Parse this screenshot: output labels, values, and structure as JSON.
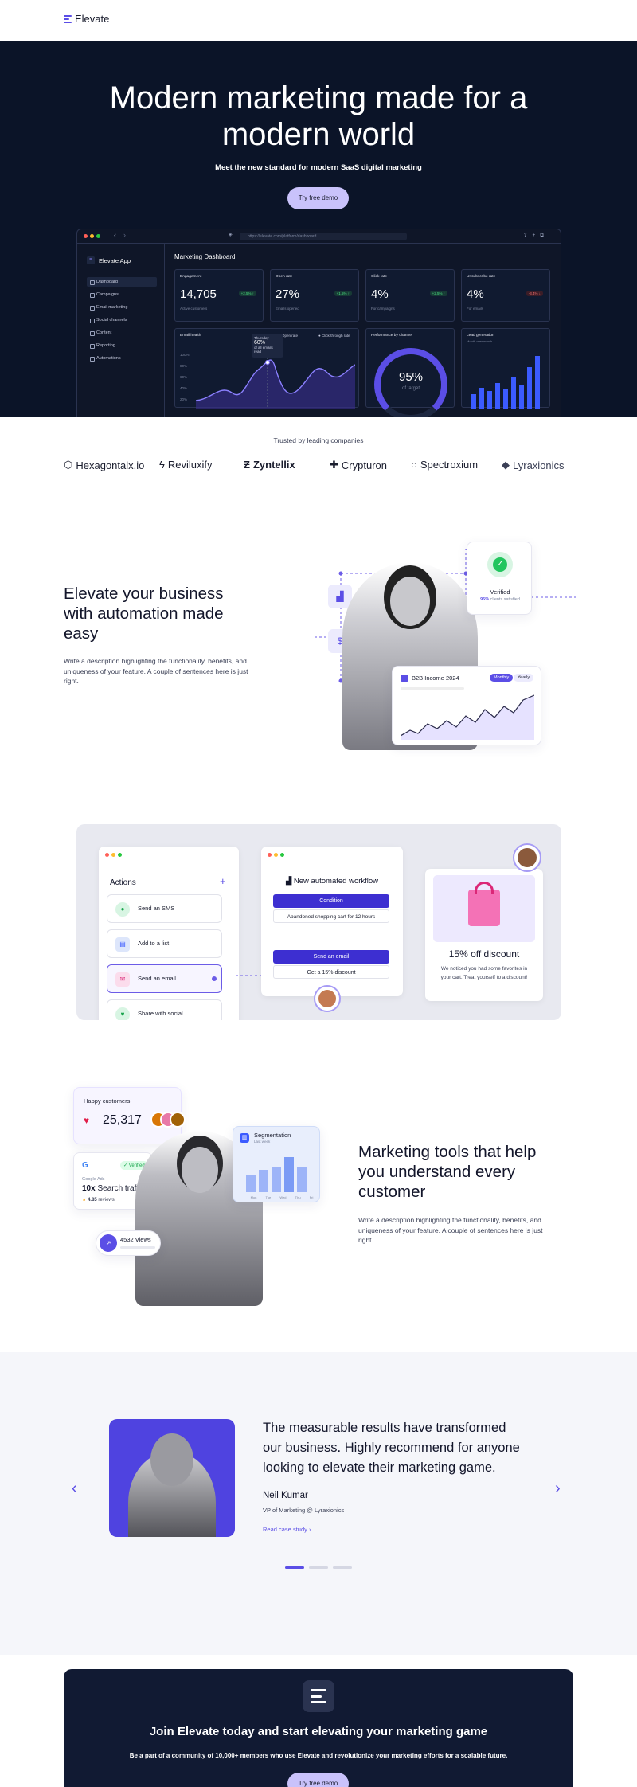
{
  "nav": {
    "brand": "Elevate"
  },
  "hero": {
    "title_line1": "Modern marketing made for a",
    "title_line2": "modern world",
    "subtitle": "Meet the new standard for modern SaaS digital marketing",
    "cta": "Try free demo"
  },
  "app": {
    "url": "https://elevate.com/platform/dashboard",
    "name": "Elevate App",
    "nav": [
      "Dashboard",
      "Campaigns",
      "Email marketing",
      "Social channels",
      "Content",
      "Reporting",
      "Automations"
    ],
    "title": "Marketing Dashboard",
    "cards": [
      {
        "label": "Engagement",
        "value": "14,705",
        "caption": "Active customers",
        "delta": "+2.5% ↑"
      },
      {
        "label": "Open rate",
        "value": "27%",
        "caption": "Emails opened",
        "delta": "+1.5% ↑"
      },
      {
        "label": "Click rate",
        "value": "4%",
        "caption": "For campaigns",
        "delta": "+2.5% ↑"
      },
      {
        "label": "Unsubscribe rate",
        "value": "4%",
        "caption": "For emails",
        "delta": "-3.4% ↓"
      }
    ],
    "email_health": {
      "label": "Email health",
      "legend_open": "Open rate",
      "legend_click": "Click-through rate",
      "tooltip_day": "Thursday",
      "tooltip_value": "60%",
      "tooltip_cap": "of all emails read",
      "ticks": [
        "100%",
        "80%",
        "60%",
        "40%",
        "20%"
      ]
    },
    "performance": {
      "label": "Performance by channel",
      "value": "95%",
      "caption": "of target"
    },
    "lead_gen": {
      "label": "Lead generation",
      "caption": "Month over month"
    }
  },
  "trusted": {
    "label": "Trusted by leading companies",
    "logos": [
      "Hexagontalx.io",
      "Reviluxify",
      "Zyntellix",
      "Crypturon",
      "Spectroxium",
      "Lyraxionics"
    ]
  },
  "feature1": {
    "title_lines": [
      "Elevate your business",
      "with automation made",
      "easy"
    ],
    "desc_lines": [
      "Write a description highlighting the functionality, benefits, and",
      "uniqueness of your feature. A couple of sentences here is just",
      "right."
    ],
    "verified": {
      "title": "Verified",
      "pct": "95%",
      "text": "clients satisfied"
    },
    "income": {
      "title": "B2B Income 2024",
      "tab_monthly": "Monthly",
      "tab_yearly": "Yearly"
    }
  },
  "workflow": {
    "actions_title": "Actions",
    "actions": [
      "Send an SMS",
      "Add to a list",
      "Send an email",
      "Share with social"
    ],
    "wf_title": "New automated workflow",
    "condition": "Condition",
    "condition_text": "Abandoned shopping cart for 12 hours",
    "send_email": "Send an email",
    "offer_text": "Get a 15% discount",
    "discount_title": "15% off discount",
    "discount_desc_lines": [
      "We noticed you had some favorites in",
      "your cart. Treat yourself to a discount!"
    ]
  },
  "feature2": {
    "title_lines": [
      "Marketing tools that help",
      "you understand every",
      "customer"
    ],
    "desc_lines": [
      "Write a description highlighting the functionality, benefits, and",
      "uniqueness of your feature. A couple of sentences here is just",
      "right."
    ],
    "happy": {
      "label": "Happy customers",
      "value": "25,317"
    },
    "google": {
      "badge": "Verified",
      "source": "Google Ads",
      "traffic_bold": "10x",
      "traffic": "Search traffic",
      "rating": "4.85",
      "reviews": "reviews"
    },
    "segmentation": {
      "title": "Segmentation",
      "caption": "Last week",
      "bars": [
        3,
        4,
        4.5,
        6,
        4
      ],
      "labels": [
        "Mon",
        "Tue",
        "Wed",
        "Thu",
        "Fri"
      ]
    },
    "views": "4532 Views"
  },
  "testimonial": {
    "quote_lines": [
      "The measurable results have transformed",
      "our business. Highly recommend for anyone",
      "looking to elevate their marketing game."
    ],
    "name": "Neil Kumar",
    "role": "VP of Marketing @ Lyraxionics",
    "link": "Read case study"
  },
  "cta": {
    "title": "Join Elevate today and start elevating your marketing game",
    "subtitle": "Be a part of a community of 10,000+ members who use Elevate and revolutionize your marketing efforts for a scalable future.",
    "button": "Try free demo"
  },
  "colors": {
    "accent": "#5b4ee6",
    "dark": "#0b1428",
    "lavender": "#c9c2fb"
  }
}
